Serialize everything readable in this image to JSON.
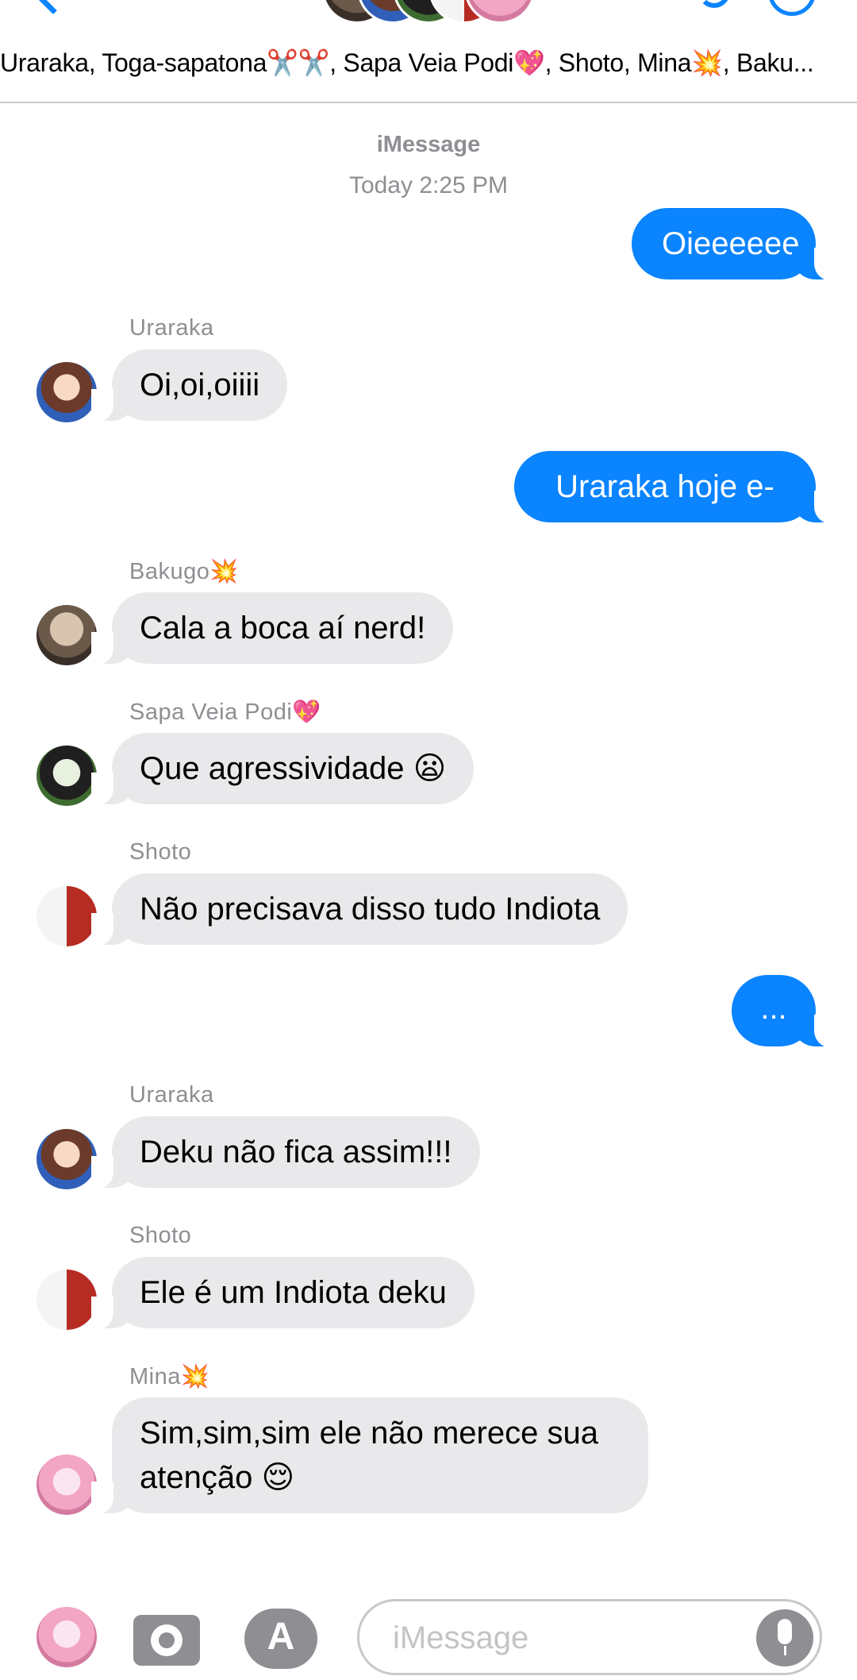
{
  "header": {
    "group_names": "Uraraka, Toga-sapatona✂️✂️, Sapa Veia Podi💖, Shoto, Mina💥, Baku..."
  },
  "thread": {
    "service": "iMessage",
    "timestamp": "Today 2:25 PM"
  },
  "messages": [
    {
      "direction": "out",
      "text": "Oieeeeee"
    },
    {
      "direction": "in",
      "sender": "Uraraka",
      "text": "Oi,oi,oiiii"
    },
    {
      "direction": "out",
      "text": "Uraraka hoje e-"
    },
    {
      "direction": "in",
      "sender": "Bakugo💥",
      "text": "Cala a boca aí nerd!"
    },
    {
      "direction": "in",
      "sender": "Sapa Veia Podi💖",
      "text": "Que agressividade 😦"
    },
    {
      "direction": "in",
      "sender": "Shoto",
      "text": "Não precisava disso tudo Indiota"
    },
    {
      "direction": "out",
      "text": "..."
    },
    {
      "direction": "in",
      "sender": "Uraraka",
      "text": "Deku não fica assim!!!"
    },
    {
      "direction": "in",
      "sender": "Shoto",
      "text": "Ele é um Indiota deku"
    },
    {
      "direction": "in",
      "sender": "Mina💥",
      "text_line1": "Sim,sim,sim ele não merece sua",
      "text_line2": "atenção 😌"
    }
  ],
  "composer": {
    "placeholder": "iMessage",
    "appstore_glyph": "A"
  },
  "colors": {
    "accent": "#0a84ff",
    "incoming_bubble": "#e9e9eb",
    "meta_text": "#8e8e93"
  },
  "icons": [
    "back-chevron-icon",
    "phone-icon",
    "info-icon",
    "camera-icon",
    "appstore-icon",
    "microphone-icon"
  ]
}
